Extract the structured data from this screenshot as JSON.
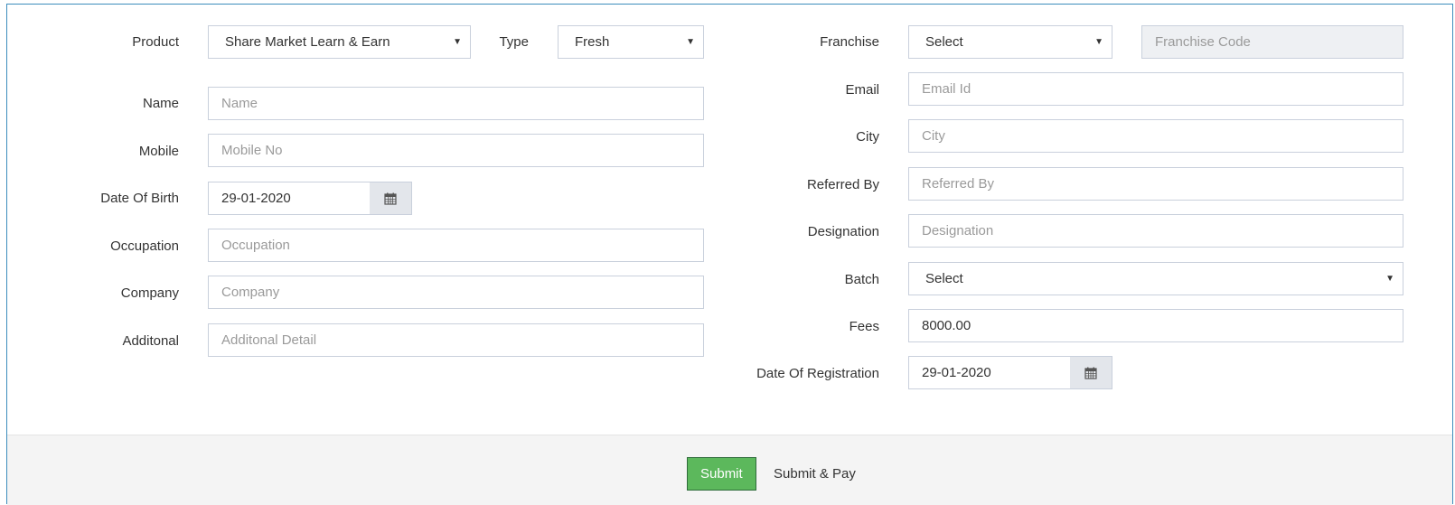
{
  "left": {
    "product": {
      "label": "Product",
      "value": "Share Market Learn & Earn"
    },
    "type": {
      "label": "Type",
      "value": "Fresh"
    },
    "name": {
      "label": "Name",
      "placeholder": "Name"
    },
    "mobile": {
      "label": "Mobile",
      "placeholder": "Mobile No"
    },
    "dob": {
      "label": "Date Of Birth",
      "value": "29-01-2020"
    },
    "occupation": {
      "label": "Occupation",
      "placeholder": "Occupation"
    },
    "company": {
      "label": "Company",
      "placeholder": "Company"
    },
    "additional": {
      "label": "Additonal",
      "placeholder": "Additonal Detail"
    }
  },
  "right": {
    "franchise": {
      "label": "Franchise",
      "value": "Select",
      "code_placeholder": "Franchise Code"
    },
    "email": {
      "label": "Email",
      "placeholder": "Email Id"
    },
    "city": {
      "label": "City",
      "placeholder": "City"
    },
    "referred_by": {
      "label": "Referred By",
      "placeholder": "Referred By"
    },
    "designation": {
      "label": "Designation",
      "placeholder": "Designation"
    },
    "batch": {
      "label": "Batch",
      "value": "Select"
    },
    "fees": {
      "label": "Fees",
      "value": "8000.00"
    },
    "registration_date": {
      "label": "Date Of Registration",
      "value": "29-01-2020"
    }
  },
  "footer": {
    "submit_label": "Submit",
    "submit_pay_label": "Submit & Pay"
  },
  "icons": {
    "select_arrow": "chevron-down-icon",
    "calendar": "calendar-icon"
  },
  "colors": {
    "border_accent": "#3c8dbc",
    "submit_bg": "#5cb85c",
    "footer_bg": "#f4f4f4",
    "addon_bg": "#e3e6eb"
  }
}
